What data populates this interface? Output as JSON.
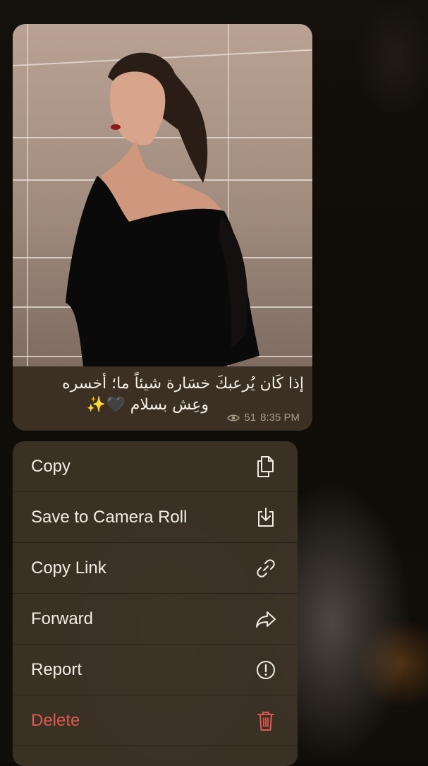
{
  "message": {
    "caption_line1": "إذا كَان يُرعبكَ خسَارة شيئاً ما؛ أخسره",
    "caption_line2": "وعِش بسلام 🖤✨",
    "views": "51",
    "time": "8:35 PM"
  },
  "context_menu": {
    "items": [
      {
        "label": "Copy",
        "icon": "copy-icon"
      },
      {
        "label": "Save to Camera Roll",
        "icon": "save-icon"
      },
      {
        "label": "Copy Link",
        "icon": "link-icon"
      },
      {
        "label": "Forward",
        "icon": "forward-icon"
      },
      {
        "label": "Report",
        "icon": "report-icon"
      },
      {
        "label": "Delete",
        "icon": "trash-icon"
      }
    ]
  },
  "colors": {
    "menu_text": "#f1ece4",
    "danger": "#e0584f",
    "meta_text": "#a99b87"
  }
}
